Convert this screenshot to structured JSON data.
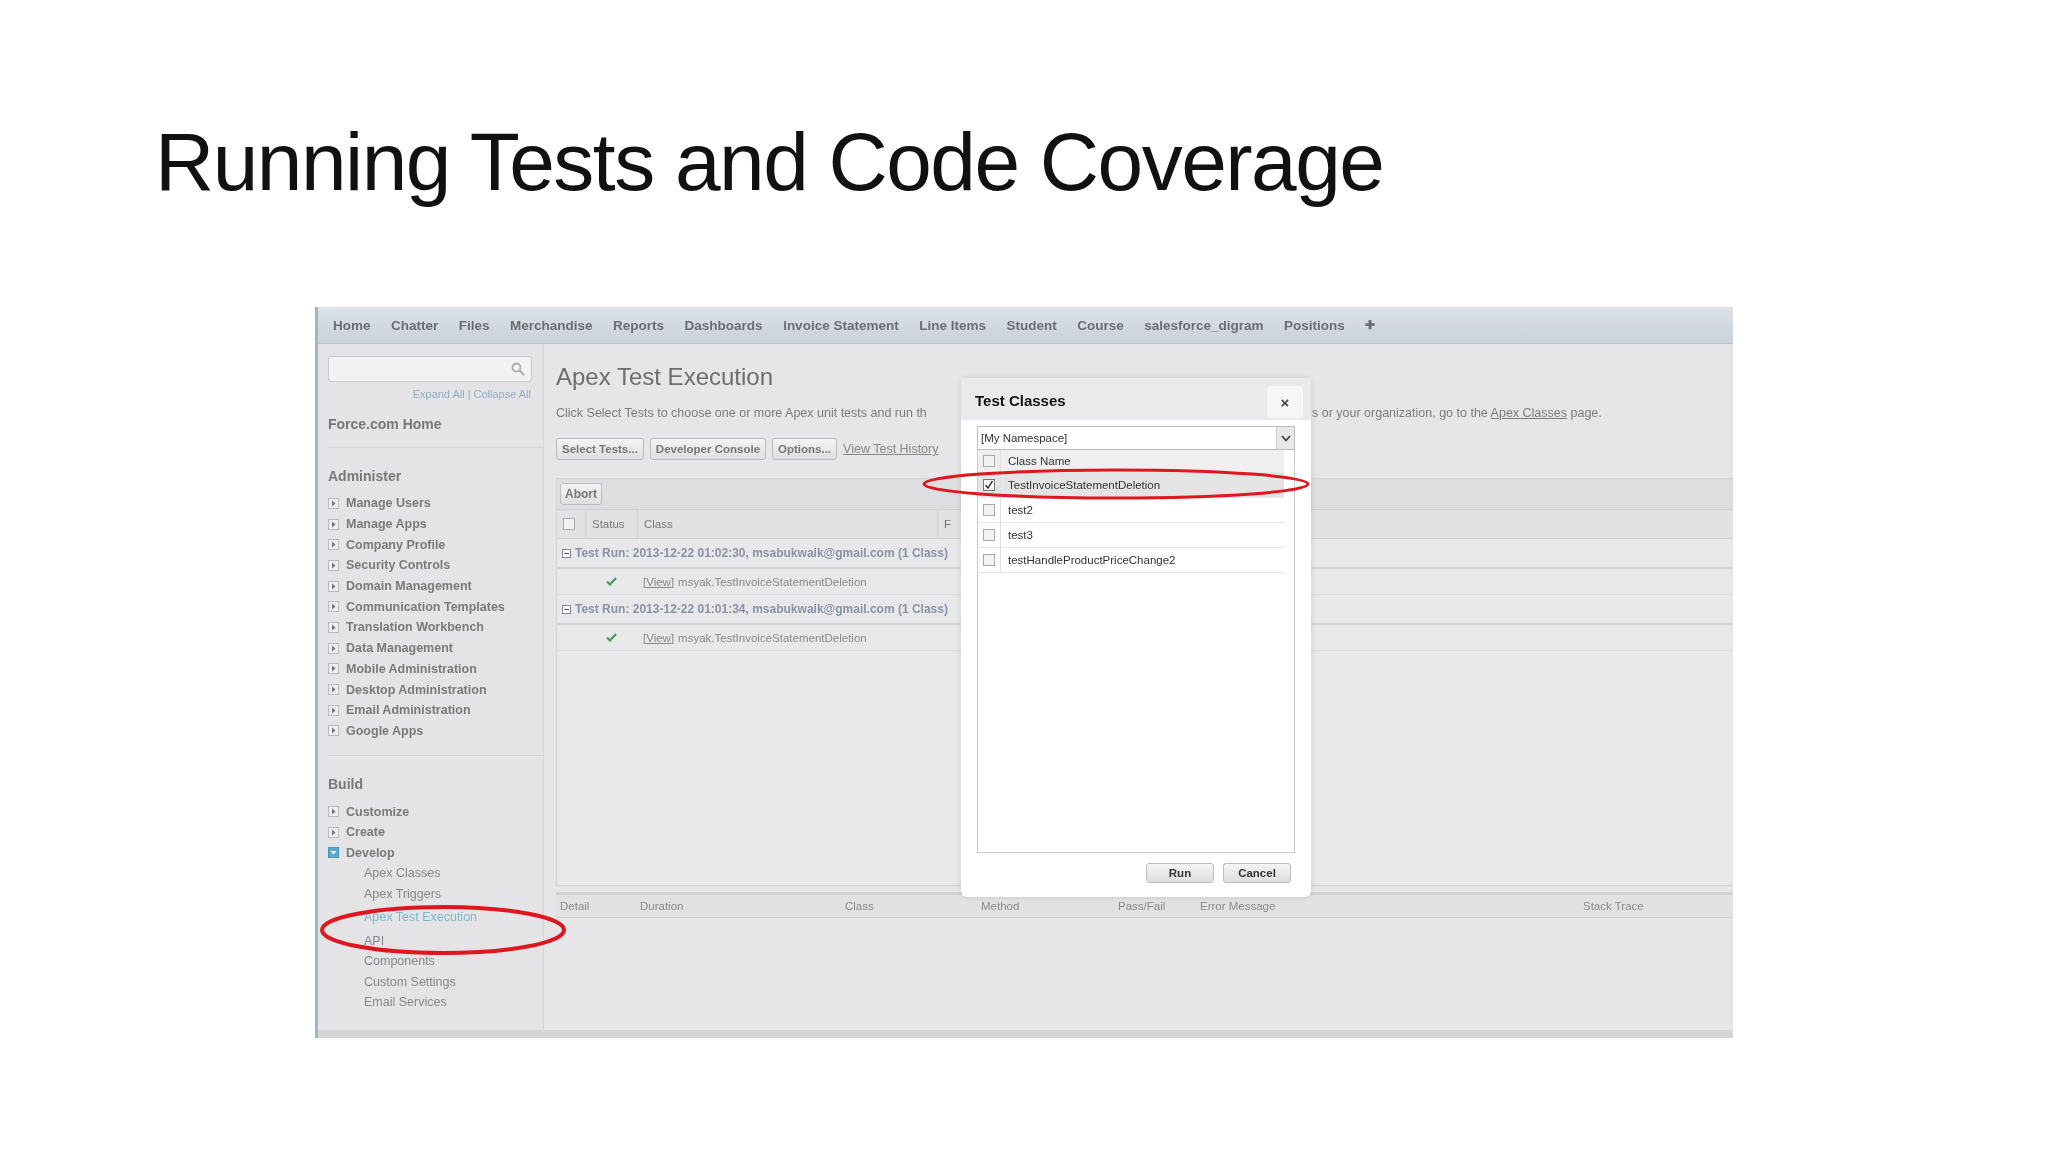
{
  "slide_title": "Running Tests and Code Coverage",
  "nav": {
    "tabs": [
      "Home",
      "Chatter",
      "Files",
      "Merchandise",
      "Reports",
      "Dashboards",
      "Invoice Statement",
      "Line Items",
      "Student",
      "Course",
      "salesforce_digram",
      "Positions"
    ],
    "add_tab": "✚"
  },
  "sidebar": {
    "expand_all": "Expand All",
    "separator": "|",
    "collapse_all": "Collapse All",
    "home": "Force.com Home",
    "sections": [
      {
        "title": "Administer",
        "items": [
          {
            "label": "Manage Users",
            "expanded": false
          },
          {
            "label": "Manage Apps",
            "expanded": false
          },
          {
            "label": "Company Profile",
            "expanded": false
          },
          {
            "label": "Security Controls",
            "expanded": false
          },
          {
            "label": "Domain Management",
            "expanded": false
          },
          {
            "label": "Communication Templates",
            "expanded": false
          },
          {
            "label": "Translation Workbench",
            "expanded": false
          },
          {
            "label": "Data Management",
            "expanded": false
          },
          {
            "label": "Mobile Administration",
            "expanded": false
          },
          {
            "label": "Desktop Administration",
            "expanded": false
          },
          {
            "label": "Email Administration",
            "expanded": false
          },
          {
            "label": "Google Apps",
            "expanded": false
          }
        ]
      },
      {
        "title": "Build",
        "items": [
          {
            "label": "Customize",
            "expanded": false
          },
          {
            "label": "Create",
            "expanded": false
          },
          {
            "label": "Develop",
            "expanded": true,
            "children": [
              {
                "label": "Apex Classes",
                "selected": false
              },
              {
                "label": "Apex Triggers",
                "selected": false
              },
              {
                "label": "Apex Test Execution",
                "selected": true
              },
              {
                "label": "API",
                "selected": false
              },
              {
                "label": "Components",
                "selected": false
              },
              {
                "label": "Custom Settings",
                "selected": false
              },
              {
                "label": "Email Services",
                "selected": false
              }
            ]
          }
        ]
      }
    ]
  },
  "main": {
    "title": "Apex Test Execution",
    "description_left": "Click Select Tests to choose one or more Apex unit tests and run th",
    "description_right": {
      "before": "s or your organization, go to the",
      "link": "Apex Classes",
      "after": "page."
    },
    "actions": [
      {
        "label": "Select Tests...",
        "kind": "button"
      },
      {
        "label": "Developer Console",
        "kind": "button"
      },
      {
        "label": "Options...",
        "kind": "button"
      },
      {
        "label": "View Test History",
        "kind": "link"
      }
    ]
  },
  "queue": {
    "abort": "Abort",
    "select_all_checked": false,
    "columns": [
      "Status",
      "Class",
      "F"
    ],
    "runs": [
      {
        "label": "Test Run: 2013-12-22 01:02:30, msabukwaik@gmail.com (1 Class)",
        "expanded": true,
        "classes": [
          {
            "passed": true,
            "view": "[View]",
            "name": "msyak.TestInvoiceStatementDeletion"
          }
        ]
      },
      {
        "label": "Test Run: 2013-12-22 01:01:34, msabukwaik@gmail.com (1 Class)",
        "expanded": true,
        "classes": [
          {
            "passed": true,
            "view": "[View]",
            "name": "msyak.TestInvoiceStatementDeletion"
          }
        ]
      }
    ]
  },
  "results": {
    "columns": [
      "Detail",
      "Duration",
      "Class",
      "Method",
      "Pass/Fail",
      "Error Message",
      "Stack Trace"
    ]
  },
  "dialog": {
    "title": "Test Classes",
    "close": "×",
    "namespace": "[My Namespace]",
    "header": "Class Name",
    "header_checked": false,
    "classes": [
      {
        "name": "TestInvoiceStatementDeletion",
        "checked": true
      },
      {
        "name": "test2",
        "checked": false
      },
      {
        "name": "test3",
        "checked": false
      },
      {
        "name": "testHandleProductPriceChange2",
        "checked": false
      }
    ],
    "buttons": [
      "Run",
      "Cancel"
    ]
  }
}
